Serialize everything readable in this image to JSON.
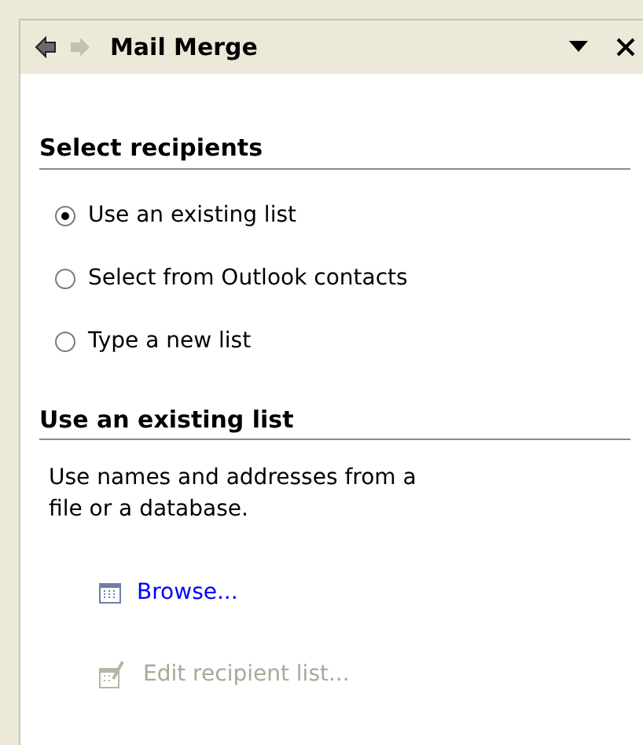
{
  "panel": {
    "title": "Mail Merge",
    "back_enabled": true,
    "forward_enabled": false
  },
  "sections": [
    {
      "heading": "Select recipients",
      "options": [
        {
          "label": "Use an existing list",
          "selected": true
        },
        {
          "label": "Select from Outlook contacts",
          "selected": false
        },
        {
          "label": "Type a new list",
          "selected": false
        }
      ]
    },
    {
      "heading": "Use an existing list",
      "description": "Use names and addresses from a file or a database.",
      "actions": [
        {
          "label": "Browse...",
          "kind": "browse",
          "disabled": false
        },
        {
          "label": "Edit recipient list...",
          "kind": "edit",
          "disabled": true
        }
      ]
    }
  ]
}
